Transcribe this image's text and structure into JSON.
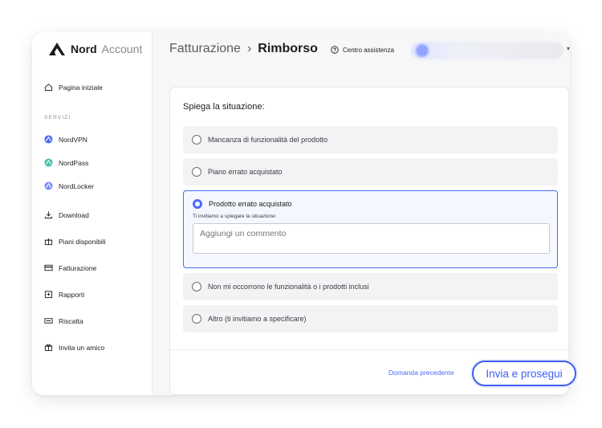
{
  "logo": {
    "brand": "Nord",
    "product": "Account"
  },
  "sidebar": {
    "section_label": "SERVIZI",
    "items": [
      {
        "label": "Pagina iniziale",
        "icon": "home-icon"
      },
      {
        "label": "NordVPN",
        "icon": "nordvpn-icon"
      },
      {
        "label": "NordPass",
        "icon": "nordpass-icon"
      },
      {
        "label": "NordLocker",
        "icon": "nordlocker-icon"
      },
      {
        "label": "Download",
        "icon": "download-icon"
      },
      {
        "label": "Piani disponibili",
        "icon": "gift-icon"
      },
      {
        "label": "Fatturazione",
        "icon": "card-icon"
      },
      {
        "label": "Rapporti",
        "icon": "report-icon"
      },
      {
        "label": "Riscatta",
        "icon": "ticket-icon"
      },
      {
        "label": "Invita un amico",
        "icon": "present-icon"
      }
    ]
  },
  "header": {
    "breadcrumb_parent": "Fatturazione",
    "breadcrumb_separator": "›",
    "breadcrumb_current": "Rimborso",
    "help_label": "Centro assistenza"
  },
  "form": {
    "title": "Spiega la situazione:",
    "options": [
      {
        "label": "Mancanza di funzionalità del prodotto",
        "selected": false
      },
      {
        "label": "Piano errato acquistato",
        "selected": false
      },
      {
        "label": "Prodotto errato acquistato",
        "selected": true
      },
      {
        "label": "Non mi occorrono le funzionalità o i prodotti inclusi",
        "selected": false
      },
      {
        "label": "Altro (ti invitiamo a specificare)",
        "selected": false
      }
    ],
    "comment_hint": "Ti invitiamo a spiegare la situazione:",
    "comment_placeholder": "Aggiungi un commento",
    "comment_value": "",
    "prev_label": "Domanda precedente",
    "submit_label": "Invia e prosegui"
  },
  "colors": {
    "accent": "#4b6bfb",
    "submit_border": "#3e5ff0"
  }
}
